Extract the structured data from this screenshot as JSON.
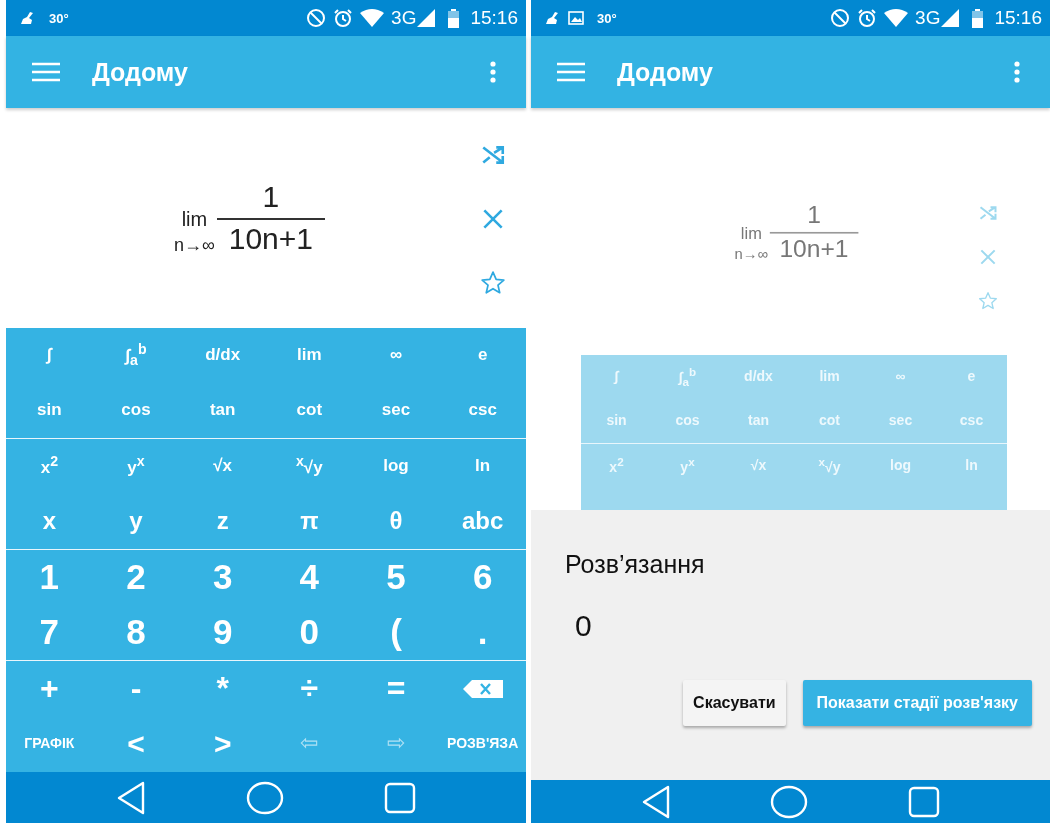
{
  "screens": [
    {
      "status_bar": {
        "image_notification": false,
        "temperature": "30°",
        "network": "3G",
        "time": "15:16"
      },
      "app_bar": {
        "title": "Додому"
      },
      "dimmed": false,
      "expression": {
        "operator": "lim",
        "under": "n→∞",
        "numerator": "1",
        "denominator": "10n+1"
      },
      "keypad": {
        "sections": [
          {
            "rows": [
              {
                "kind": "functions",
                "keys": [
                  {
                    "kind": "text",
                    "label": "∫",
                    "disabled": false
                  },
                  {
                    "kind": "text",
                    "label": "∫$_{a}$$^{b}$",
                    "disabled": false
                  },
                  {
                    "kind": "text",
                    "label": "d/dx",
                    "disabled": false
                  },
                  {
                    "kind": "text",
                    "label": "lim",
                    "disabled": false
                  },
                  {
                    "kind": "text",
                    "label": "∞",
                    "disabled": false
                  },
                  {
                    "kind": "text",
                    "label": "e",
                    "disabled": false
                  }
                ]
              },
              {
                "kind": "functions",
                "keys": [
                  {
                    "kind": "text",
                    "label": "sin",
                    "disabled": false
                  },
                  {
                    "kind": "text",
                    "label": "cos",
                    "disabled": false
                  },
                  {
                    "kind": "text",
                    "label": "tan",
                    "disabled": false
                  },
                  {
                    "kind": "text",
                    "label": "cot",
                    "disabled": false
                  },
                  {
                    "kind": "text",
                    "label": "sec",
                    "disabled": false
                  },
                  {
                    "kind": "text",
                    "label": "csc",
                    "disabled": false
                  }
                ]
              }
            ]
          },
          {
            "rows": [
              {
                "kind": "functions",
                "keys": [
                  {
                    "kind": "text",
                    "label": "x$^{2}$",
                    "disabled": false
                  },
                  {
                    "kind": "text",
                    "label": "y$^{x}$",
                    "disabled": false
                  },
                  {
                    "kind": "text",
                    "label": "√x",
                    "disabled": false
                  },
                  {
                    "kind": "text",
                    "label": "$^{x}$√y",
                    "disabled": false
                  },
                  {
                    "kind": "text",
                    "label": "log",
                    "disabled": false
                  },
                  {
                    "kind": "text",
                    "label": "ln",
                    "disabled": false
                  }
                ]
              },
              {
                "kind": "variables",
                "keys": [
                  {
                    "kind": "text",
                    "label": "x",
                    "disabled": false
                  },
                  {
                    "kind": "text",
                    "label": "y",
                    "disabled": false
                  },
                  {
                    "kind": "text",
                    "label": "z",
                    "disabled": false
                  },
                  {
                    "kind": "text",
                    "label": "π",
                    "disabled": false
                  },
                  {
                    "kind": "text",
                    "label": "θ",
                    "disabled": false
                  },
                  {
                    "kind": "text",
                    "label": "abc",
                    "disabled": false
                  }
                ]
              }
            ]
          },
          {
            "rows": [
              {
                "kind": "digits",
                "keys": [
                  {
                    "kind": "text",
                    "label": "1",
                    "disabled": false
                  },
                  {
                    "kind": "text",
                    "label": "2",
                    "disabled": false
                  },
                  {
                    "kind": "text",
                    "label": "3",
                    "disabled": false
                  },
                  {
                    "kind": "text",
                    "label": "4",
                    "disabled": false
                  },
                  {
                    "kind": "text",
                    "label": "5",
                    "disabled": false
                  },
                  {
                    "kind": "text",
                    "label": "6",
                    "disabled": false
                  }
                ]
              },
              {
                "kind": "digits",
                "keys": [
                  {
                    "kind": "text",
                    "label": "7",
                    "disabled": false
                  },
                  {
                    "kind": "text",
                    "label": "8",
                    "disabled": false
                  },
                  {
                    "kind": "text",
                    "label": "9",
                    "disabled": false
                  },
                  {
                    "kind": "text",
                    "label": "0",
                    "disabled": false
                  },
                  {
                    "kind": "text",
                    "label": "(",
                    "disabled": false
                  },
                  {
                    "kind": "text",
                    "label": ".",
                    "disabled": false
                  }
                ]
              }
            ]
          },
          {
            "rows": [
              {
                "kind": "operators",
                "keys": [
                  {
                    "kind": "text",
                    "label": "+",
                    "disabled": false
                  },
                  {
                    "kind": "text",
                    "label": "-",
                    "disabled": false
                  },
                  {
                    "kind": "text",
                    "label": "*",
                    "disabled": false
                  },
                  {
                    "kind": "text",
                    "label": "÷",
                    "disabled": false
                  },
                  {
                    "kind": "text",
                    "label": "=",
                    "disabled": false
                  },
                  {
                    "kind": "backspace",
                    "disabled": false
                  }
                ]
              },
              {
                "kind": "controls",
                "keys": [
                  {
                    "kind": "word",
                    "label": "ГРАФІК",
                    "disabled": false
                  },
                  {
                    "kind": "text",
                    "label": "<",
                    "disabled": false
                  },
                  {
                    "kind": "text",
                    "label": ">",
                    "disabled": false
                  },
                  {
                    "kind": "text",
                    "label": "⇦",
                    "disabled": true
                  },
                  {
                    "kind": "text",
                    "label": "⇨",
                    "disabled": true
                  },
                  {
                    "kind": "word",
                    "label": "РОЗВ'ЯЗА",
                    "disabled": false
                  }
                ]
              }
            ]
          }
        ]
      }
    },
    {
      "status_bar": {
        "image_notification": true,
        "temperature": "30°",
        "network": "3G",
        "time": "15:16"
      },
      "app_bar": {
        "title": "Додому"
      },
      "dimmed": true,
      "expression": {
        "operator": "lim",
        "under": "n→∞",
        "numerator": "1",
        "denominator": "10n+1"
      },
      "keypad": {
        "sections": [
          {
            "rows": [
              {
                "kind": "functions",
                "keys": [
                  {
                    "kind": "text",
                    "label": "∫",
                    "disabled": false
                  },
                  {
                    "kind": "text",
                    "label": "∫$_{a}$$^{b}$",
                    "disabled": false
                  },
                  {
                    "kind": "text",
                    "label": "d/dx",
                    "disabled": false
                  },
                  {
                    "kind": "text",
                    "label": "lim",
                    "disabled": false
                  },
                  {
                    "kind": "text",
                    "label": "∞",
                    "disabled": false
                  },
                  {
                    "kind": "text",
                    "label": "e",
                    "disabled": false
                  }
                ]
              },
              {
                "kind": "functions",
                "keys": [
                  {
                    "kind": "text",
                    "label": "sin",
                    "disabled": false
                  },
                  {
                    "kind": "text",
                    "label": "cos",
                    "disabled": false
                  },
                  {
                    "kind": "text",
                    "label": "tan",
                    "disabled": false
                  },
                  {
                    "kind": "text",
                    "label": "cot",
                    "disabled": false
                  },
                  {
                    "kind": "text",
                    "label": "sec",
                    "disabled": false
                  },
                  {
                    "kind": "text",
                    "label": "csc",
                    "disabled": false
                  }
                ]
              }
            ]
          },
          {
            "rows": [
              {
                "kind": "functions",
                "keys": [
                  {
                    "kind": "text",
                    "label": "x$^{2}$",
                    "disabled": false
                  },
                  {
                    "kind": "text",
                    "label": "y$^{x}$",
                    "disabled": false
                  },
                  {
                    "kind": "text",
                    "label": "√x",
                    "disabled": false
                  },
                  {
                    "kind": "text",
                    "label": "$^{x}$√y",
                    "disabled": false
                  },
                  {
                    "kind": "text",
                    "label": "log",
                    "disabled": false
                  },
                  {
                    "kind": "text",
                    "label": "ln",
                    "disabled": false
                  }
                ]
              }
            ]
          }
        ]
      },
      "dialog": {
        "title": "Розв’язання",
        "result": "0",
        "buttons": [
          {
            "kind": "secondary",
            "label": "Скасувати"
          },
          {
            "kind": "primary",
            "label": "Показати стадії розв'язку"
          }
        ]
      }
    }
  ]
}
